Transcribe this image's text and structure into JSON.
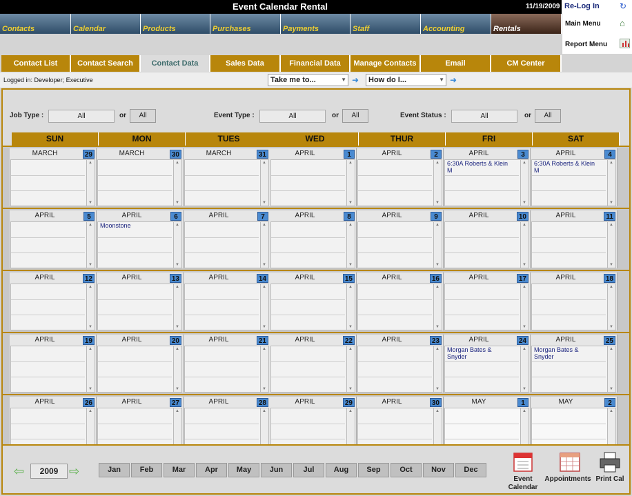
{
  "header": {
    "title": "Event Calendar Rental",
    "date": "11/19/2009",
    "relogin": "Re-Log In"
  },
  "modules": [
    "Contacts",
    "Calendar",
    "Products",
    "Purchases",
    "Payments",
    "Staff",
    "Accounting",
    "Rentals"
  ],
  "side_menu": {
    "main_menu": "Main Menu",
    "report_menu": "Report Menu"
  },
  "subtabs": [
    "Contact List",
    "Contact Search",
    "Contact Data",
    "Sales Data",
    "Financial Data",
    "Manage Contacts",
    "Email",
    "CM Center"
  ],
  "status": {
    "logged_in": "Logged in: Developer; Executive",
    "take_me_to": "Take me to...",
    "how_do_i": "How do I..."
  },
  "filters": {
    "job_type_label": "Job Type :",
    "job_type_value": "All",
    "event_type_label": "Event Type :",
    "event_type_value": "All",
    "event_status_label": "Event Status :",
    "event_status_value": "All",
    "or": "or",
    "all_btn": "All"
  },
  "days": [
    "SUN",
    "MON",
    "TUES",
    "WED",
    "THUR",
    "FRI",
    "SAT"
  ],
  "weeks": [
    [
      {
        "month": "MARCH",
        "day": "29",
        "events": []
      },
      {
        "month": "MARCH",
        "day": "30",
        "events": []
      },
      {
        "month": "MARCH",
        "day": "31",
        "events": []
      },
      {
        "month": "APRIL",
        "day": "1",
        "events": []
      },
      {
        "month": "APRIL",
        "day": "2",
        "events": []
      },
      {
        "month": "APRIL",
        "day": "3",
        "events": [
          "6:30A Roberts & Klein",
          "M"
        ]
      },
      {
        "month": "APRIL",
        "day": "4",
        "events": [
          "6:30A Roberts & Klein",
          "M"
        ]
      }
    ],
    [
      {
        "month": "APRIL",
        "day": "5",
        "events": []
      },
      {
        "month": "APRIL",
        "day": "6",
        "events": [
          "Moonstone"
        ]
      },
      {
        "month": "APRIL",
        "day": "7",
        "events": []
      },
      {
        "month": "APRIL",
        "day": "8",
        "events": []
      },
      {
        "month": "APRIL",
        "day": "9",
        "events": []
      },
      {
        "month": "APRIL",
        "day": "10",
        "events": []
      },
      {
        "month": "APRIL",
        "day": "11",
        "events": []
      }
    ],
    [
      {
        "month": "APRIL",
        "day": "12",
        "events": []
      },
      {
        "month": "APRIL",
        "day": "13",
        "events": []
      },
      {
        "month": "APRIL",
        "day": "14",
        "events": []
      },
      {
        "month": "APRIL",
        "day": "15",
        "events": []
      },
      {
        "month": "APRIL",
        "day": "16",
        "events": []
      },
      {
        "month": "APRIL",
        "day": "17",
        "events": []
      },
      {
        "month": "APRIL",
        "day": "18",
        "events": []
      }
    ],
    [
      {
        "month": "APRIL",
        "day": "19",
        "events": []
      },
      {
        "month": "APRIL",
        "day": "20",
        "events": []
      },
      {
        "month": "APRIL",
        "day": "21",
        "events": []
      },
      {
        "month": "APRIL",
        "day": "22",
        "events": []
      },
      {
        "month": "APRIL",
        "day": "23",
        "events": []
      },
      {
        "month": "APRIL",
        "day": "24",
        "events": [
          "Morgan Bates &",
          "Snyder"
        ]
      },
      {
        "month": "APRIL",
        "day": "25",
        "events": [
          "Morgan Bates &",
          "Snyder"
        ]
      }
    ],
    [
      {
        "month": "APRIL",
        "day": "26",
        "events": []
      },
      {
        "month": "APRIL",
        "day": "27",
        "events": []
      },
      {
        "month": "APRIL",
        "day": "28",
        "events": []
      },
      {
        "month": "APRIL",
        "day": "29",
        "events": []
      },
      {
        "month": "APRIL",
        "day": "30",
        "events": []
      },
      {
        "month": "MAY",
        "day": "1",
        "events": []
      },
      {
        "month": "MAY",
        "day": "2",
        "events": []
      }
    ]
  ],
  "footer": {
    "year": "2009",
    "months": [
      "Jan",
      "Feb",
      "Mar",
      "Apr",
      "May",
      "Jun",
      "Jul",
      "Aug",
      "Sep",
      "Oct",
      "Nov",
      "Dec"
    ],
    "event_calendar": "Event Calendar",
    "appointments": "Appointments",
    "print_cal": "Print Cal"
  }
}
